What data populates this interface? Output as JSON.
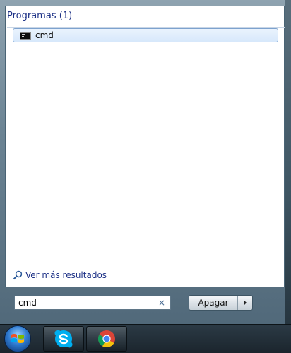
{
  "results": {
    "section_header": "Programas (1)",
    "items": [
      {
        "label": "cmd",
        "icon": "command-prompt-icon"
      }
    ],
    "more_results_label": "Ver más resultados"
  },
  "search": {
    "value": "cmd",
    "clear_icon": "×"
  },
  "shutdown": {
    "label": "Apagar"
  },
  "taskbar": {
    "buttons": [
      {
        "name": "skype",
        "icon": "skype-icon"
      },
      {
        "name": "chrome",
        "icon": "chrome-icon"
      }
    ]
  },
  "colors": {
    "header_text": "#1e3287",
    "selection_border": "#7da2ce",
    "skype_blue": "#00aff0",
    "chrome_red": "#db4437",
    "chrome_yellow": "#f4c20d",
    "chrome_green": "#0f9d58",
    "chrome_blue": "#4285f4"
  }
}
